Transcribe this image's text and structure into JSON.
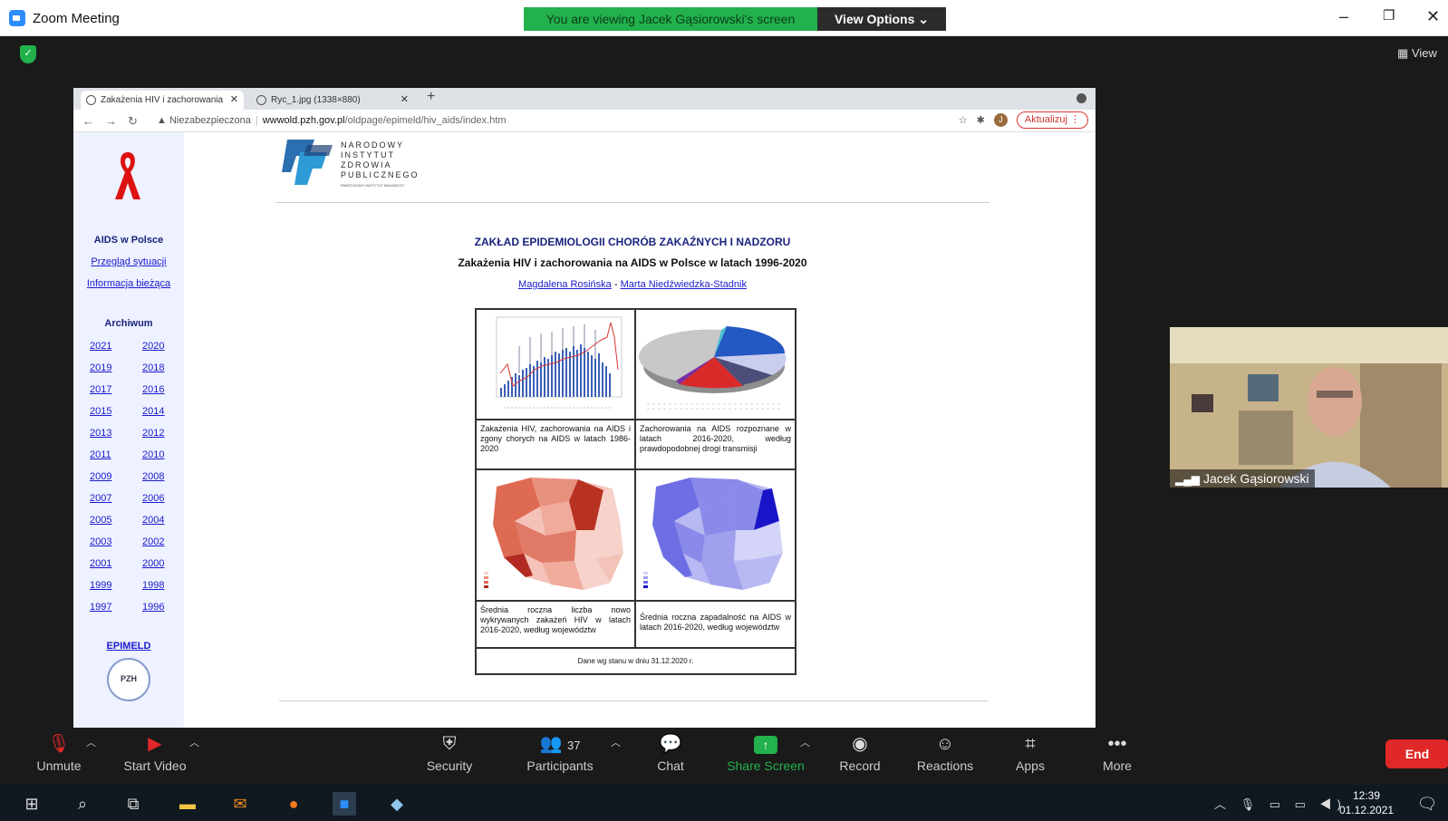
{
  "zoom": {
    "app_title": "Zoom Meeting",
    "banner_text": "You are viewing Jacek Gąsiorowski's screen",
    "view_options": "View Options ⌄",
    "view_label": "View",
    "participant_name": "Jacek Gąsiorowski",
    "participants_count": "37",
    "toolbar": {
      "unmute": "Unmute",
      "start_video": "Start Video",
      "security": "Security",
      "participants": "Participants",
      "chat": "Chat",
      "share_screen": "Share Screen",
      "record": "Record",
      "reactions": "Reactions",
      "apps": "Apps",
      "more": "More",
      "end": "End"
    },
    "colors": {
      "share_green": "#22b14c",
      "end_red": "#e02828",
      "accent": "#2d8cff"
    }
  },
  "browser": {
    "tabs": [
      {
        "label": "Zakażenia HIV i zachorowania"
      },
      {
        "label": "Ryc_1.jpg (1338×880)"
      }
    ],
    "security_label": "Niezabezpieczona",
    "url_host": "wwwold.pzh.gov.pl",
    "url_path": "/oldpage/epimeld/hiv_aids/index.htm",
    "avatar_letter": "J",
    "update_button": "Aktualizuj"
  },
  "site": {
    "logo_lines": [
      "NARODOWY",
      "INSTYTUT",
      "ZDROWIA",
      "PUBLICZNEGO"
    ],
    "logo_sub": "PAŃSTWOWY INSTYTUT BADAWCZY",
    "sidebar": {
      "heading": "AIDS w Polsce",
      "links": [
        "Przegląd sytuacji",
        "Informacja bieżąca"
      ],
      "archive_heading": "Archiwum",
      "years": [
        [
          "2021",
          "2020"
        ],
        [
          "2019",
          "2018"
        ],
        [
          "2017",
          "2016"
        ],
        [
          "2015",
          "2014"
        ],
        [
          "2013",
          "2012"
        ],
        [
          "2011",
          "2010"
        ],
        [
          "2009",
          "2008"
        ],
        [
          "2007",
          "2006"
        ],
        [
          "2005",
          "2004"
        ],
        [
          "2003",
          "2002"
        ],
        [
          "2001",
          "2000"
        ],
        [
          "1999",
          "1998"
        ],
        [
          "1997",
          "1996"
        ]
      ],
      "epimeld": "EPIMELD"
    },
    "heading1": "ZAKŁAD EPIDEMIOLOGII CHORÓB ZAKAŹNYCH I NADZORU",
    "heading2": "Zakażenia HIV i zachorowania na AIDS w Polsce w latach 1996-2020",
    "author1": "Magdalena Rosińska",
    "author_sep": " - ",
    "author2": "Marta Niedźwiedzka-Stadnik",
    "captions": [
      "Zakażenia HIV, zachorowania na AIDS i zgony chorych na AIDS w latach 1986-2020",
      "Zachorowania na AIDS rozpoznane w latach 2016-2020, według prawdopodobnej drogi transmisji",
      "Średnia roczna liczba nowo wykrywanych zakażeń HIV w latach 2016-2020, według województw",
      "Średnia roczna zapadalność na AIDS w latach 2016-2020, według województw"
    ],
    "footer": "Dane wg stanu w dniu 31.12.2020 r."
  },
  "taskbar": {
    "time": "12:39",
    "date": "01.12.2021"
  }
}
